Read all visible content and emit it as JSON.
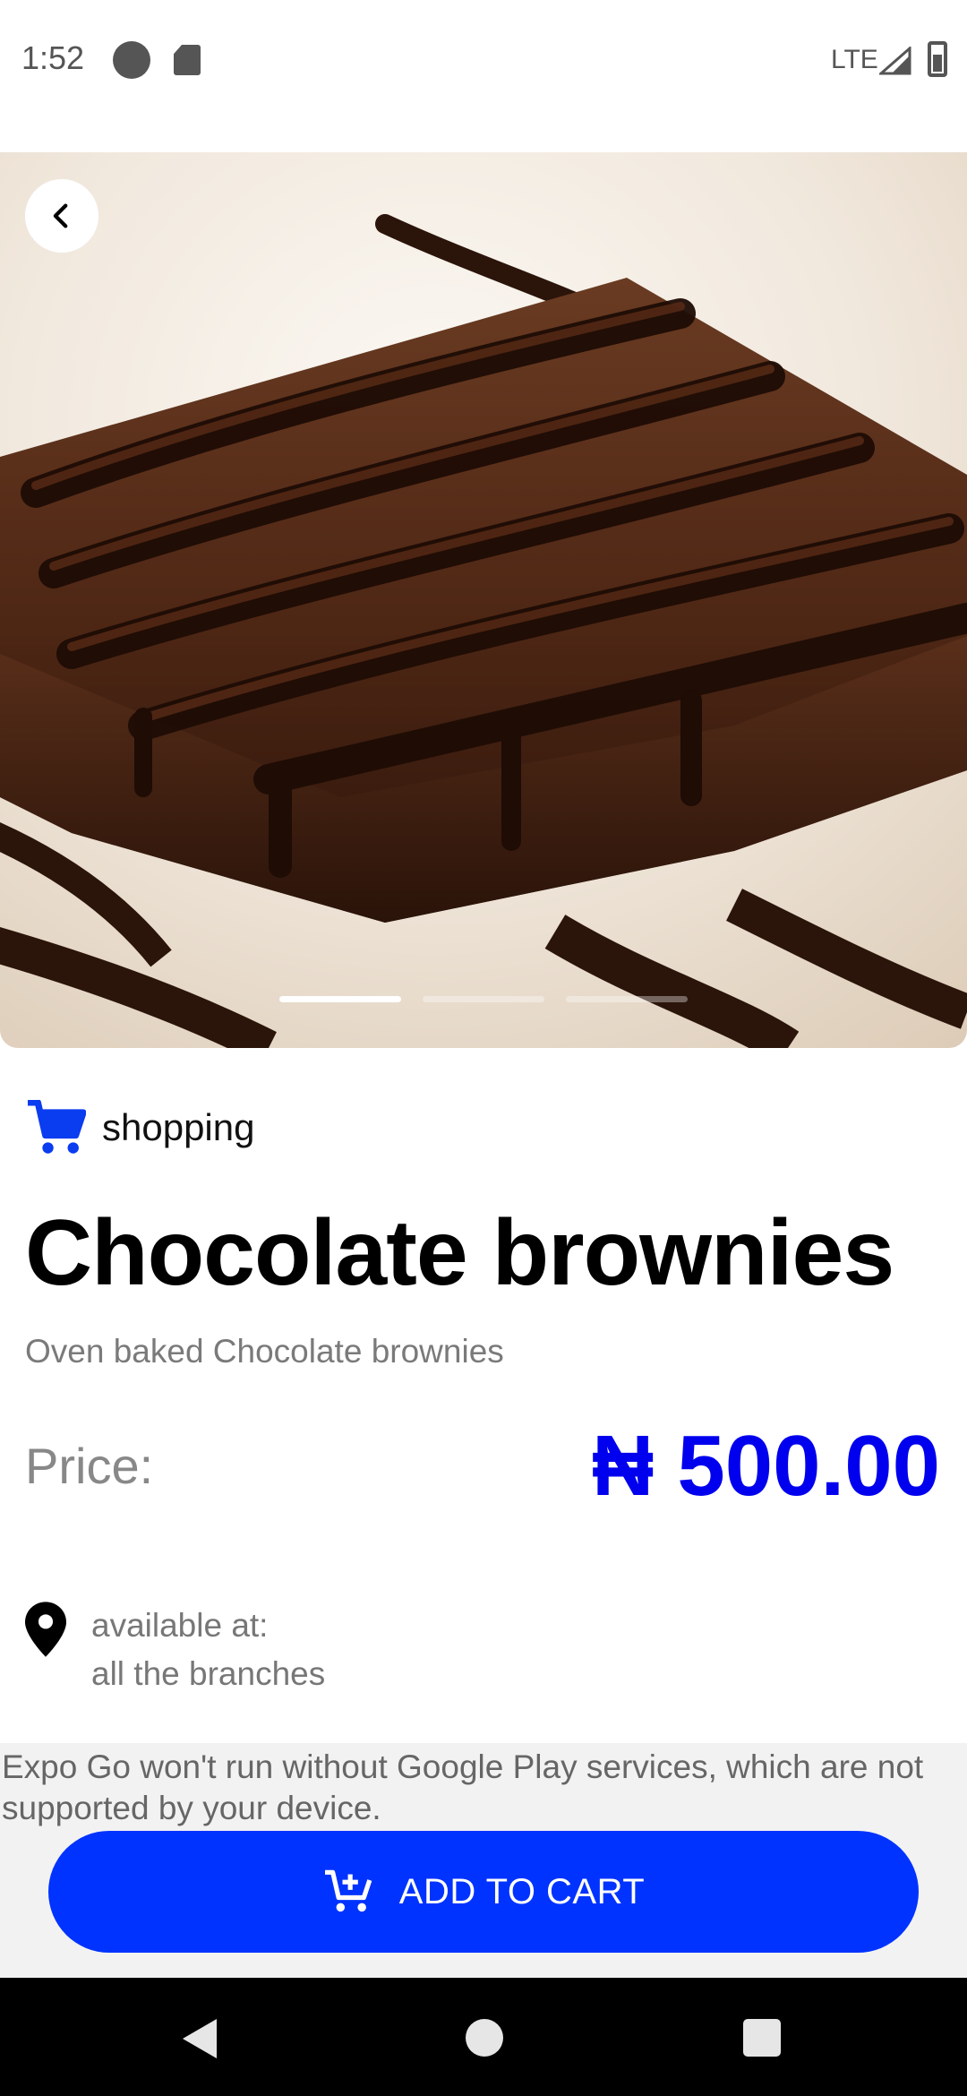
{
  "status_bar": {
    "time": "1:52",
    "network": "LTE"
  },
  "hero": {
    "image_subject": "chocolate brownie with chocolate syrup",
    "slides": 3,
    "active_slide": 1
  },
  "product": {
    "category": "shopping",
    "title": "Chocolate brownies",
    "description": "Oven baked Chocolate brownies",
    "price_label": "Price:",
    "currency_symbol": "₦",
    "price": "500.00",
    "availability_label": "available at:",
    "availability_value": "all the branches"
  },
  "warning": {
    "text": "Expo Go won't run without Google Play services, which are not supported by your device."
  },
  "cart_button": {
    "label": "ADD TO CART"
  },
  "colors": {
    "accent": "#0033ff",
    "price": "#0000ee",
    "muted": "#7a7a7a"
  },
  "icons": [
    "back-arrow-icon",
    "shopping-cart-icon",
    "location-pin-icon",
    "add-to-cart-icon"
  ]
}
